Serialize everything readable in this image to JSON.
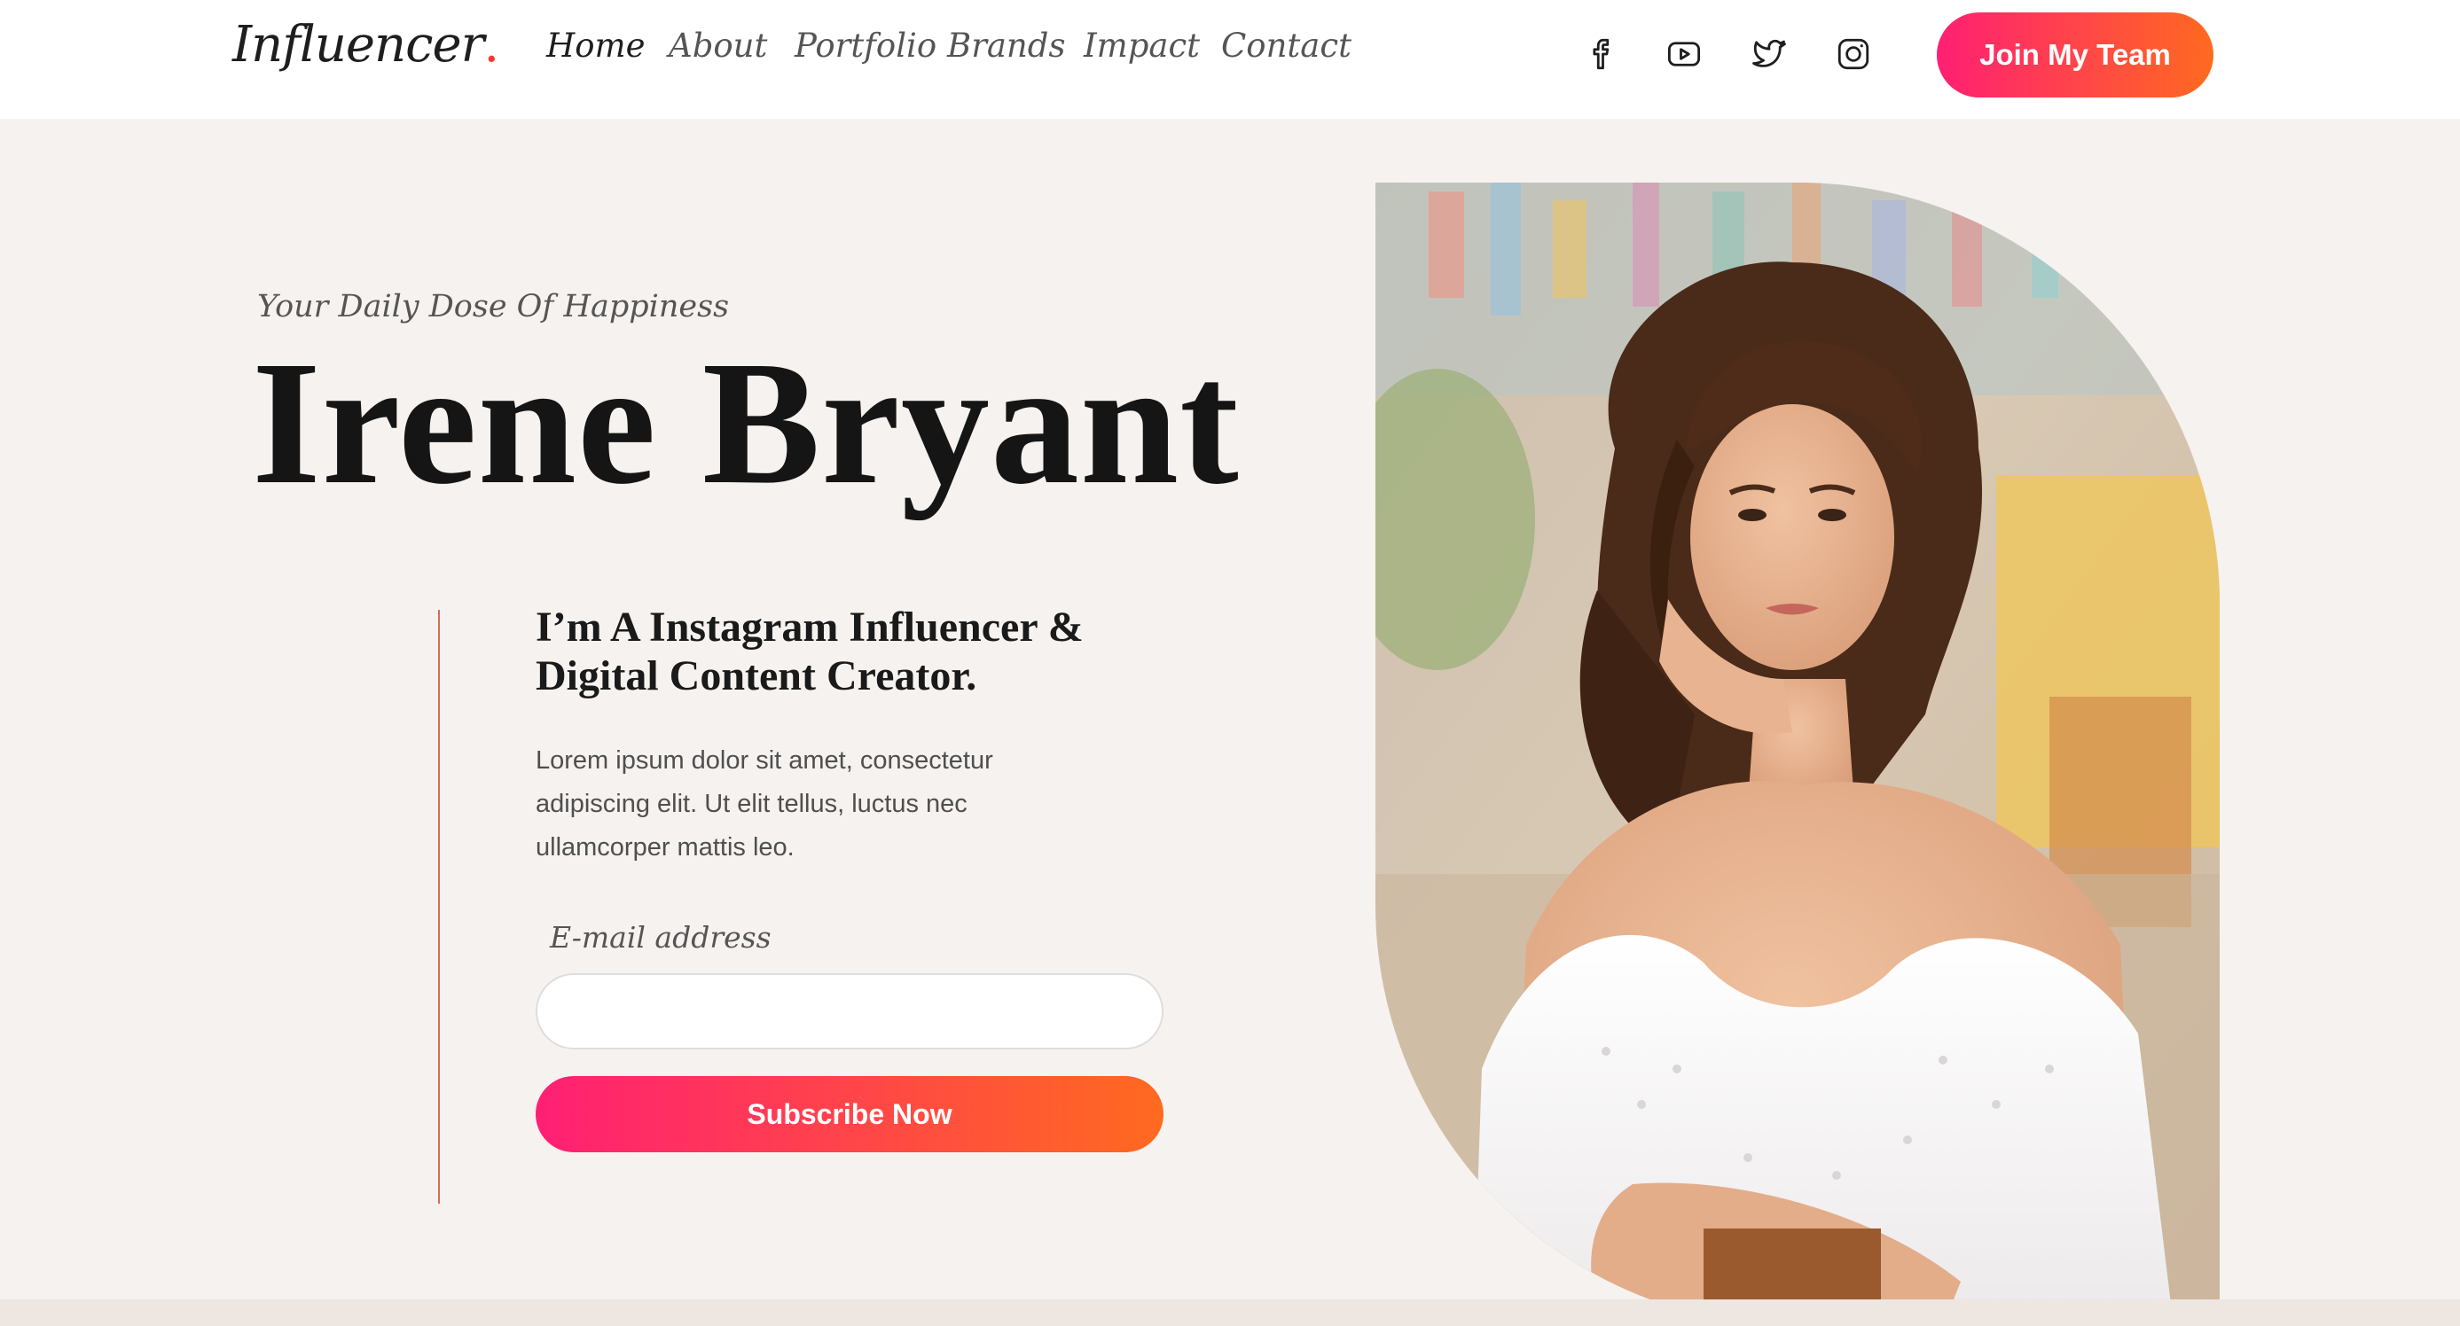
{
  "header": {
    "logo_text": "Influencer",
    "logo_dot": ".",
    "nav": [
      {
        "label": "Home",
        "active": true
      },
      {
        "label": "About",
        "active": false
      },
      {
        "label": "Portfolio",
        "active": false
      },
      {
        "label": "Brands",
        "active": false
      },
      {
        "label": "Impact",
        "active": false
      },
      {
        "label": "Contact",
        "active": false
      }
    ],
    "social_icons": [
      "facebook-icon",
      "youtube-icon",
      "twitter-icon",
      "instagram-icon"
    ],
    "cta_label": "Join My Team"
  },
  "hero": {
    "tagline": "Your Daily Dose Of Happiness",
    "name": "Irene Bryant",
    "intro_heading": "I’m A Instagram Influencer & Digital Content Creator.",
    "intro_body": "Lorem ipsum dolor sit amet, consectetur adipiscing elit. Ut elit tellus, luctus nec ullamcorper mattis leo.",
    "email_label": "E-mail address",
    "email_value": "",
    "email_placeholder": "",
    "subscribe_label": "Subscribe Now",
    "photo_subject": "portrait of a curly-haired woman in a white off-shoulder dress, resting chin on hand"
  },
  "colors": {
    "accent_start": "#ff1f74",
    "accent_end": "#ff6a1f",
    "logo_dot": "#f23b2c",
    "page_bg": "#f6f2ef",
    "header_bg": "#ffffff",
    "divider_line": "#d96b5a"
  }
}
